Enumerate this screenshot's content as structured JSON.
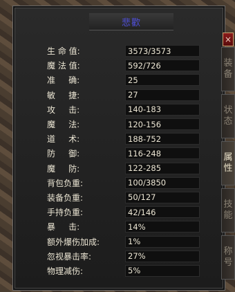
{
  "window": {
    "title": "悲歡"
  },
  "close_label": "×",
  "tabs": [
    {
      "label": [
        "装",
        "备"
      ],
      "active": false
    },
    {
      "label": [
        "状",
        "态"
      ],
      "active": false
    },
    {
      "label": [
        "属",
        "性"
      ],
      "active": true
    },
    {
      "label": [
        "技",
        "能"
      ],
      "active": false
    },
    {
      "label": [
        "称",
        "号"
      ],
      "active": false
    }
  ],
  "stats": [
    {
      "label": "生 命 值:",
      "value": "3573/3573"
    },
    {
      "label": "魔 法 值:",
      "value": "592/726"
    },
    {
      "label": "准     确:",
      "value": "25"
    },
    {
      "label": "敏     捷:",
      "value": "27"
    },
    {
      "label": "攻     击:",
      "value": "140-183"
    },
    {
      "label": "魔     法:",
      "value": "120-156"
    },
    {
      "label": "道     术:",
      "value": "188-752"
    },
    {
      "label": "防     御:",
      "value": "116-248"
    },
    {
      "label": "魔     防:",
      "value": "122-285"
    },
    {
      "label": "背包负重:",
      "value": "100/3850"
    },
    {
      "label": "装备负重:",
      "value": "50/127"
    },
    {
      "label": "手持负重:",
      "value": "42/146"
    },
    {
      "label": "暴     击:",
      "value": "14%"
    },
    {
      "label": "额外爆伤加成:",
      "value": "1%"
    },
    {
      "label": "忽视暴击率:",
      "value": "27%"
    },
    {
      "label": "物理减伤:",
      "value": "5%"
    }
  ],
  "colors": {
    "title": "#4f4fd8",
    "text": "#ece6d4",
    "close": "#8a1b1b"
  }
}
